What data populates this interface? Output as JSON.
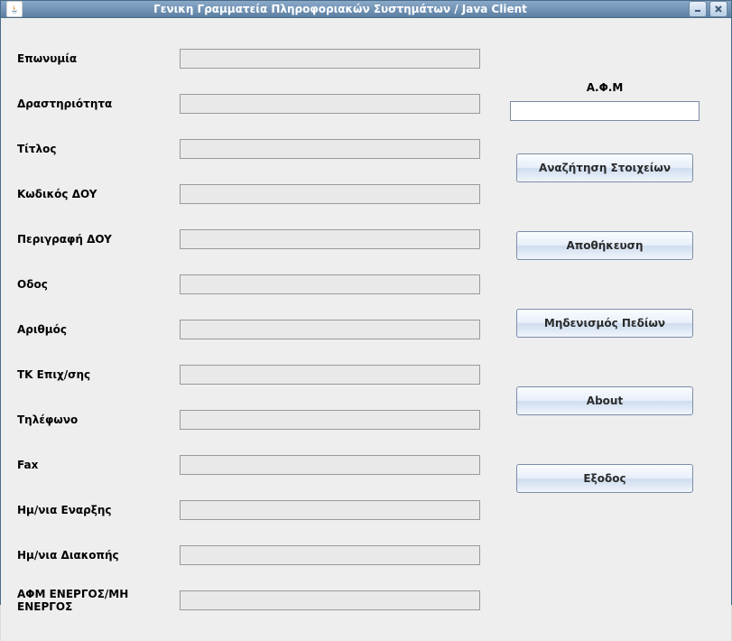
{
  "window": {
    "title": "Γενικη Γραμματεία Πληροφοριακών Συστημάτων / Java Client"
  },
  "form": {
    "fields": [
      {
        "label": "Επωνυμία",
        "value": ""
      },
      {
        "label": "Δραστηριότητα",
        "value": ""
      },
      {
        "label": "Τίτλος",
        "value": ""
      },
      {
        "label": "Κωδικός ΔOY",
        "value": ""
      },
      {
        "label": "Περιγραφή ΔOY",
        "value": ""
      },
      {
        "label": "Οδος",
        "value": ""
      },
      {
        "label": "Αριθμός",
        "value": ""
      },
      {
        "label": "ΤΚ Επιχ/σης",
        "value": ""
      },
      {
        "label": "Τηλέφωνο",
        "value": ""
      },
      {
        "label": "Fax",
        "value": ""
      },
      {
        "label": "Ημ/νια Εναρξης",
        "value": ""
      },
      {
        "label": "Ημ/νια Διακοπής",
        "value": ""
      },
      {
        "label": "ΑΦΜ ΕΝΕΡΓΟΣ/ΜΗ ΕΝΕΡΓΟΣ",
        "value": ""
      }
    ]
  },
  "side": {
    "afm_label": "Α.Φ.Μ",
    "afm_value": "",
    "buttons": {
      "search": "Αναζήτηση Στοιχείων",
      "save": "Αποθήκευση",
      "reset": "Μηδενισμός Πεδίων",
      "about": "About",
      "exit": "Εξοδος"
    }
  }
}
